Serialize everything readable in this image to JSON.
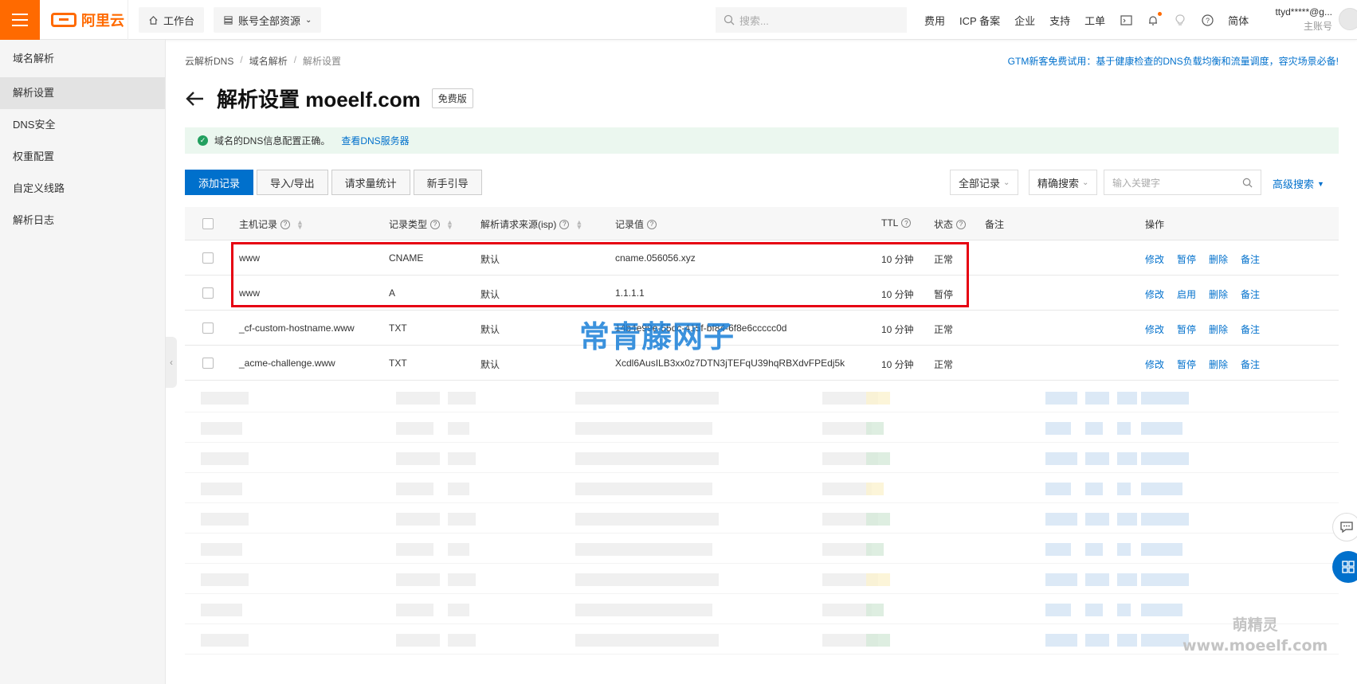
{
  "topbar": {
    "logo_text": "阿里云",
    "workbench": "工作台",
    "resources": "账号全部资源",
    "search_placeholder": "搜索...",
    "links": [
      "费用",
      "ICP 备案",
      "企业",
      "支持",
      "工单"
    ],
    "lang": "简体",
    "user_name": "ttyd*****@g...",
    "user_role": "主账号"
  },
  "sidebar": {
    "items": [
      "域名解析",
      "解析设置",
      "DNS安全",
      "权重配置",
      "自定义线路",
      "解析日志"
    ],
    "active": "解析设置"
  },
  "breadcrumb": [
    "云解析DNS",
    "域名解析",
    "解析设置"
  ],
  "promo": "GTM新客免费试用：基于健康检查的DNS负载均衡和流量调度，容灾场景必备!",
  "page": {
    "title": "解析设置 moeelf.com",
    "badge": "免费版"
  },
  "alert": {
    "text": "域名的DNS信息配置正确。",
    "link": "查看DNS服务器"
  },
  "toolbar": {
    "add": "添加记录",
    "import_export": "导入/导出",
    "stats": "请求量统计",
    "guide": "新手引导"
  },
  "filters": {
    "all_records": "全部记录",
    "precise": "精确搜索",
    "keyword_placeholder": "输入关键字",
    "advanced": "高级搜索"
  },
  "table": {
    "headers": {
      "host": "主机记录",
      "type": "记录类型",
      "isp": "解析请求来源(isp)",
      "value": "记录值",
      "ttl": "TTL",
      "status": "状态",
      "remark": "备注",
      "ops": "操作"
    },
    "rows": [
      {
        "host": "www",
        "type": "CNAME",
        "isp": "默认",
        "value": "cname.056056.xyz",
        "ttl": "10 分钟",
        "status": "正常",
        "toggle": "暂停"
      },
      {
        "host": "www",
        "type": "A",
        "isp": "默认",
        "value": "1.1.1.1",
        "ttl": "10 分钟",
        "status": "暂停",
        "toggle": "启用"
      },
      {
        "host": "_cf-custom-hostname.www",
        "type": "TXT",
        "isp": "默认",
        "value": "14b4e99e-55dc-415f-bf84-6f8e6ccccc0d",
        "ttl": "10 分钟",
        "status": "正常",
        "toggle": "暂停"
      },
      {
        "host": "_acme-challenge.www",
        "type": "TXT",
        "isp": "默认",
        "value": "Xcdl6AusILB3xx0z7DTN3jTEFqU39hqRBXdvFPEdj5k",
        "ttl": "10 分钟",
        "status": "正常",
        "toggle": "暂停"
      }
    ],
    "op_edit": "修改",
    "op_delete": "删除",
    "op_remark": "备注"
  },
  "watermark": "常青藤网子",
  "watermark2": {
    "line1": "萌精灵",
    "line2": "www.moeelf.com"
  },
  "colors": {
    "brand": "#ff6a00",
    "primary": "#0070cc",
    "ok": "#22a05f",
    "pause": "#f5a623",
    "highlight": "#e60012"
  }
}
